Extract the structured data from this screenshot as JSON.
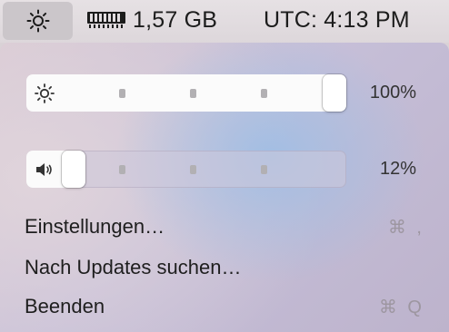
{
  "menubar": {
    "brightness_icon": "sun-icon",
    "ram_icon": "memory-chip-icon",
    "memory_text": "1,57 GB",
    "time_text": "UTC: 4:13 PM"
  },
  "brightness": {
    "icon": "sun-icon",
    "value_percent": 100,
    "label": "100%"
  },
  "volume": {
    "icon": "speaker-icon",
    "value_percent": 12,
    "label": "12%"
  },
  "menu": {
    "items": [
      {
        "label": "Einstellungen…",
        "shortcut": "⌘ ,"
      },
      {
        "label": "Nach Updates suchen…",
        "shortcut": ""
      },
      {
        "label": "Beenden",
        "shortcut": "⌘ Q"
      }
    ]
  }
}
